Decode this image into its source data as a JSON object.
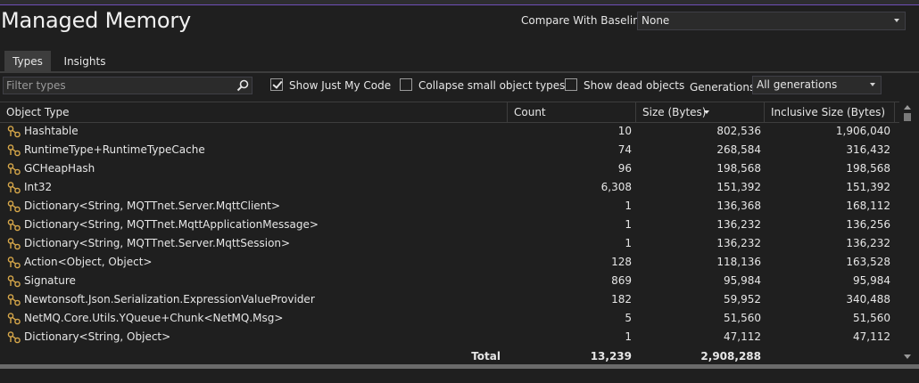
{
  "page": {
    "title": "Managed Memory"
  },
  "baseline": {
    "label": "Compare With Baseline:",
    "selected": "None"
  },
  "tabs": [
    {
      "label": "Types"
    },
    {
      "label": "Insights"
    }
  ],
  "filter": {
    "placeholder": "Filter types",
    "value": ""
  },
  "options": {
    "just_my_code": {
      "label": "Show Just My Code",
      "checked": true
    },
    "collapse_small": {
      "label": "Collapse small object types",
      "checked": false
    },
    "dead_objects": {
      "label": "Show dead objects",
      "checked": false
    },
    "generations_label": "Generations:",
    "generations_selected": "All generations"
  },
  "table": {
    "columns": [
      "Object Type",
      "Count",
      "Size (Bytes)",
      "Inclusive Size (Bytes)"
    ],
    "sort_column": "Size (Bytes)",
    "sort_direction": "descending",
    "rows": [
      {
        "type": "Hashtable",
        "count": "10",
        "size": "802,536",
        "inclusive": "1,906,040"
      },
      {
        "type": "RuntimeType+RuntimeTypeCache",
        "count": "74",
        "size": "268,584",
        "inclusive": "316,432"
      },
      {
        "type": "GCHeapHash",
        "count": "96",
        "size": "198,568",
        "inclusive": "198,568"
      },
      {
        "type": "Int32",
        "count": "6,308",
        "size": "151,392",
        "inclusive": "151,392"
      },
      {
        "type": "Dictionary<String, MQTTnet.Server.MqttClient>",
        "count": "1",
        "size": "136,368",
        "inclusive": "168,112"
      },
      {
        "type": "Dictionary<String, MQTTnet.MqttApplicationMessage>",
        "count": "1",
        "size": "136,232",
        "inclusive": "136,256"
      },
      {
        "type": "Dictionary<String, MQTTnet.Server.MqttSession>",
        "count": "1",
        "size": "136,232",
        "inclusive": "136,232"
      },
      {
        "type": "Action<Object, Object>",
        "count": "128",
        "size": "118,136",
        "inclusive": "163,528"
      },
      {
        "type": "Signature",
        "count": "869",
        "size": "95,984",
        "inclusive": "95,984"
      },
      {
        "type": "Newtonsoft.Json.Serialization.ExpressionValueProvider",
        "count": "182",
        "size": "59,952",
        "inclusive": "340,488"
      },
      {
        "type": "NetMQ.Core.Utils.YQueue+Chunk<NetMQ.Msg>",
        "count": "5",
        "size": "51,560",
        "inclusive": "51,560"
      },
      {
        "type": "Dictionary<String, Object>",
        "count": "1",
        "size": "47,112",
        "inclusive": "47,112"
      }
    ],
    "total": {
      "label": "Total",
      "count": "13,239",
      "size": "2,908,288"
    }
  }
}
